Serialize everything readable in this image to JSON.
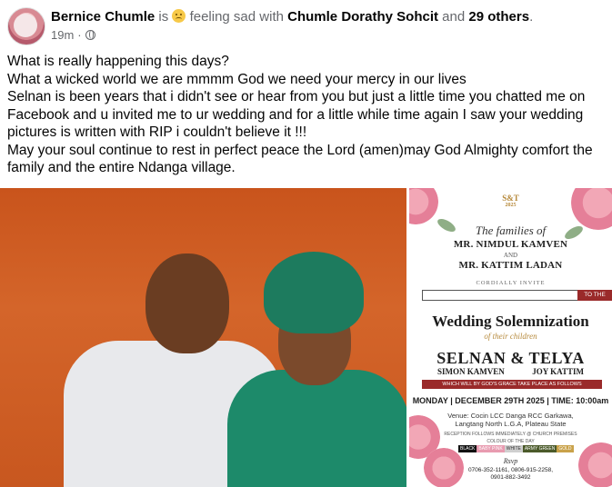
{
  "post": {
    "author": "Bernice Chumle",
    "is_text": "is",
    "feeling_text": "feeling sad with",
    "tagged": "Chumle Dorathy Sohcit",
    "and_text": "and",
    "others": "29 others",
    "period": ".",
    "time": "19m",
    "separator": "·",
    "feeling_icon": "sad-face-emoji",
    "privacy_icon": "globe-icon",
    "lines": [
      "What is really happening this days?",
      "What a wicked world we are mmmm God we need your mercy in our lives",
      "Selnan is been years that i didn't see or hear from you but just a little time you chatted me on Facebook and u invited me to ur wedding and for a little while time again I saw your wedding pictures is written with RIP i couldn't believe it !!!",
      "May your soul continue to rest in perfect peace the Lord (amen)may God Almighty comfort the family and the entire Ndanga village."
    ]
  },
  "invitation": {
    "logo": "S&T",
    "logo_year": "2025",
    "families": "The families of",
    "family1": "MR. NIMDUL KAMVEN",
    "and": "AND",
    "family2": "MR. KATTIM LADAN",
    "cordially": "CORDIALLY INVITE",
    "to_the": "TO THE",
    "title": "Wedding Solemnization",
    "of_children": "of their children",
    "couple": "SELNAN & TELYA",
    "groom": "SIMON KAMVEN",
    "bride": "JOY KATTIM",
    "grace": "WHICH WILL BY GOD'S GRACE TAKE PLACE AS FOLLOWS",
    "date": "MONDAY | DECEMBER 29TH 2025 | TIME: 10:00am",
    "venue1": "Venue: Cocin LCC Danga RCC Garkawa,",
    "venue2": "Langtang North L.G.A, Plateau State",
    "reception": "RECEPTION FOLLOWS IMMEDIATELY @ CHURCH PREMISES",
    "colour_label": "COLOUR OF THE DAY",
    "colours": [
      "BLACK",
      "BABY PINK",
      "WHITE",
      "ARMY GREEN",
      "GOLD"
    ],
    "colour_hex": [
      "#111111",
      "#e89bb0",
      "#cfcfcf",
      "#4b5a2a",
      "#c9a24a"
    ],
    "rsvp": "Rsvp",
    "phones1": "0706-352-1161, 0806-915-2258,",
    "phones2": "0901-882-3492"
  }
}
